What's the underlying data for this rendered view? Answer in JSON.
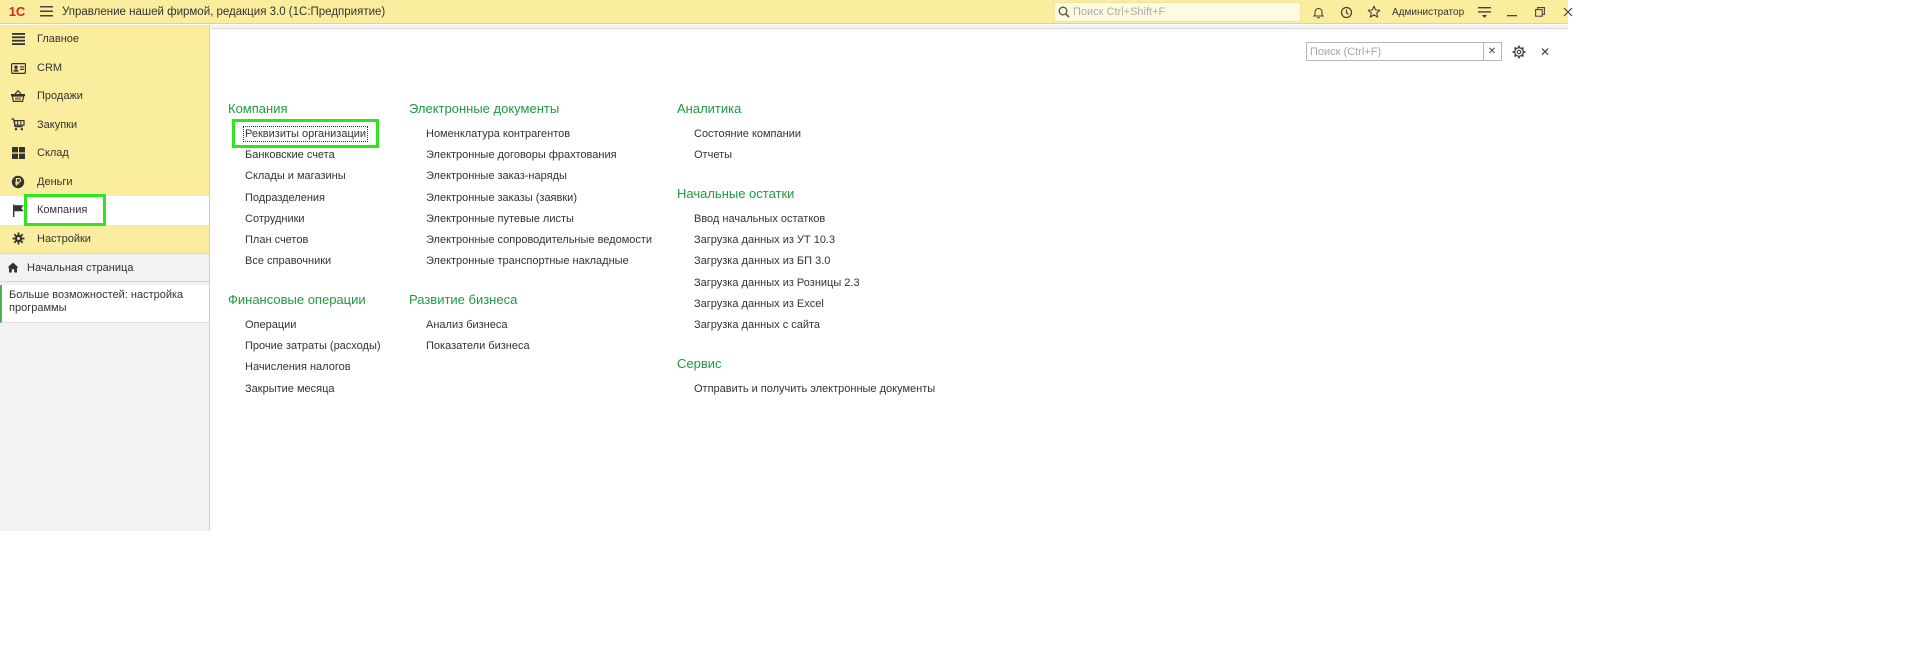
{
  "titlebar": {
    "logo": "1С",
    "app_title": "Управление нашей фирмой, редакция 3.0  (1С:Предприятие)",
    "search_placeholder": "Поиск Ctrl+Shift+F",
    "user": "Администратор"
  },
  "sidebar": {
    "items": [
      {
        "label": "Главное",
        "icon": "menu-lines-icon"
      },
      {
        "label": "CRM",
        "icon": "contact-card-icon"
      },
      {
        "label": "Продажи",
        "icon": "basket-icon"
      },
      {
        "label": "Закупки",
        "icon": "cart-icon"
      },
      {
        "label": "Склад",
        "icon": "grid-icon"
      },
      {
        "label": "Деньги",
        "icon": "coin-icon"
      },
      {
        "label": "Компания",
        "icon": "flag-icon",
        "active": true
      },
      {
        "label": "Настройки",
        "icon": "gear-icon"
      }
    ],
    "home": "Начальная страница",
    "more": "Больше возможностей: настройка программы"
  },
  "main": {
    "search_placeholder": "Поиск (Ctrl+F)",
    "columns": [
      {
        "groups": [
          {
            "title": "Компания",
            "links": [
              "Реквизиты организации",
              "Банковские счета",
              "Склады и магазины",
              "Подразделения",
              "Сотрудники",
              "План счетов",
              "Все справочники"
            ]
          },
          {
            "title": "Финансовые операции",
            "links": [
              "Операции",
              "Прочие затраты (расходы)",
              "Начисления налогов",
              "Закрытие месяца"
            ]
          }
        ]
      },
      {
        "groups": [
          {
            "title": "Электронные документы",
            "links": [
              "Номенклатура контрагентов",
              "Электронные договоры фрахтования",
              "Электронные заказ-наряды",
              "Электронные заказы (заявки)",
              "Электронные путевые листы",
              "Электронные сопроводительные ведомости",
              "Электронные транспортные накладные"
            ]
          },
          {
            "title": "Развитие бизнеса",
            "links": [
              "Анализ бизнеса",
              "Показатели бизнеса"
            ]
          }
        ]
      },
      {
        "groups": [
          {
            "title": "Аналитика",
            "links": [
              "Состояние компании",
              "Отчеты"
            ]
          },
          {
            "title": "Начальные остатки",
            "links": [
              "Ввод начальных остатков",
              "Загрузка данных из УТ 10.3",
              "Загрузка данных из БП 3.0",
              "Загрузка данных из Розницы 2.3",
              "Загрузка данных из Excel",
              "Загрузка данных с сайта"
            ]
          },
          {
            "title": "Сервис",
            "links": [
              "Отправить и получить электронные документы"
            ]
          }
        ]
      }
    ]
  },
  "colors": {
    "titlebar_bg": "#fbed9e",
    "group_title": "#1f9b3e",
    "highlight": "#2ee620"
  }
}
